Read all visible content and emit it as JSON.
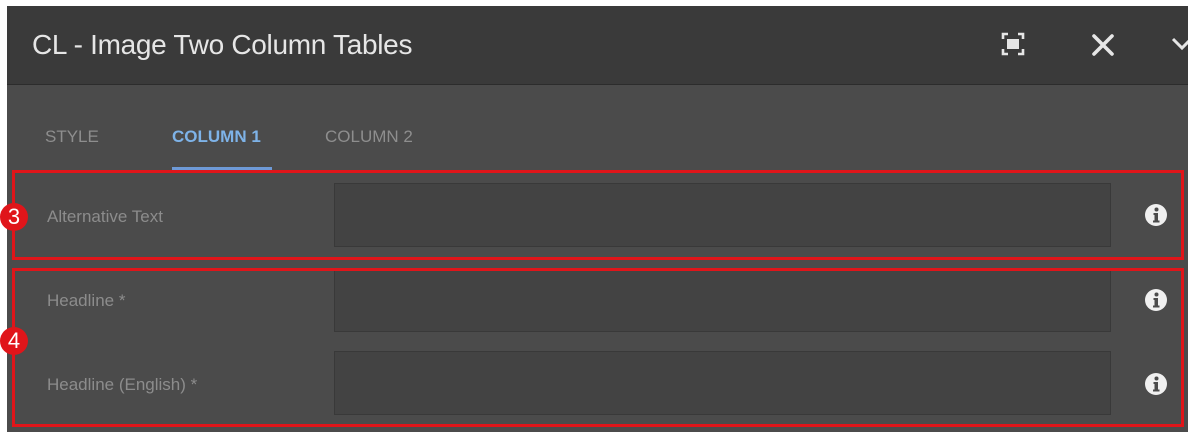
{
  "dialog": {
    "title": "CL - Image Two Column Tables",
    "icons": {
      "fullscreen": "fullscreen-icon",
      "close": "close-icon",
      "collapse": "chevron-down-icon"
    }
  },
  "tabs": [
    {
      "label": "STYLE",
      "active": false
    },
    {
      "label": "COLUMN 1",
      "active": true
    },
    {
      "label": "COLUMN 2",
      "active": false
    }
  ],
  "fields": [
    {
      "label": "Alternative Text",
      "value": "",
      "info_icon": "info-icon"
    },
    {
      "label": "Headline *",
      "value": "",
      "info_icon": "info-icon"
    },
    {
      "label": "Headline (English) *",
      "value": "",
      "info_icon": "info-icon"
    }
  ],
  "annotations": [
    {
      "number": "3"
    },
    {
      "number": "4"
    }
  ],
  "colors": {
    "accent": "#7eb3e8",
    "annotation": "#e0151a",
    "panel": "#4b4b4b",
    "titlebar": "#3a3a3a"
  }
}
